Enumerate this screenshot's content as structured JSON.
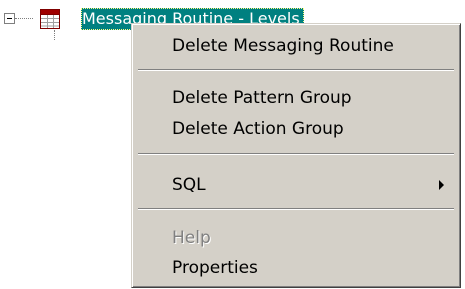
{
  "tree": {
    "node_label": "Messaging Routine - Levels",
    "node_icon": "table-icon"
  },
  "context_menu": {
    "items": [
      {
        "label": "Delete Messaging Routine",
        "enabled": true
      },
      {
        "label": "Delete Pattern Group",
        "enabled": true
      },
      {
        "label": "Delete Action Group",
        "enabled": true
      },
      {
        "label": "SQL",
        "enabled": true,
        "has_submenu": true
      },
      {
        "label": "Help",
        "enabled": false
      },
      {
        "label": "Properties",
        "enabled": true
      }
    ]
  },
  "colors": {
    "selection_bg": "#008080",
    "selection_text": "#ffffff",
    "menu_bg": "#d4d0c8",
    "disabled_text": "#808080"
  }
}
